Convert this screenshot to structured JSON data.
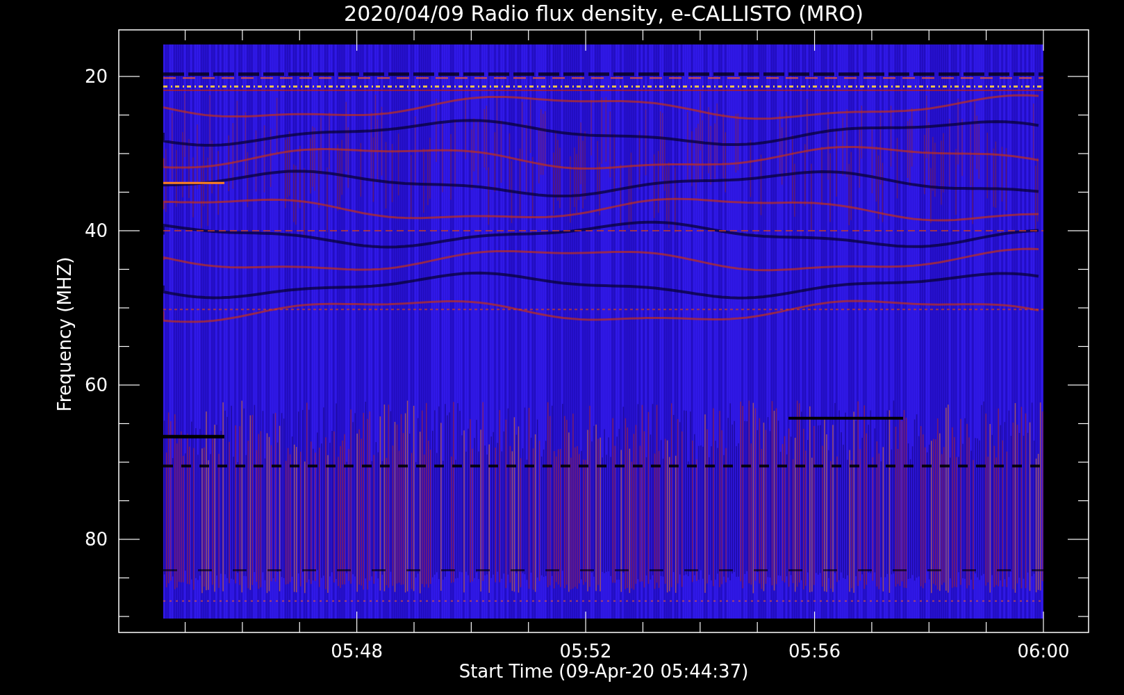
{
  "title": "2020/04/09  Radio flux density, e-CALLISTO (MRO)",
  "y_axis": {
    "label": "Frequency (MHZ)",
    "tick_labels": [
      "20",
      "40",
      "60",
      "80"
    ]
  },
  "x_axis": {
    "label": "Start Time (09-Apr-20 05:44:37)",
    "tick_labels": [
      "05:48",
      "05:52",
      "05:56",
      "06:00"
    ]
  }
}
